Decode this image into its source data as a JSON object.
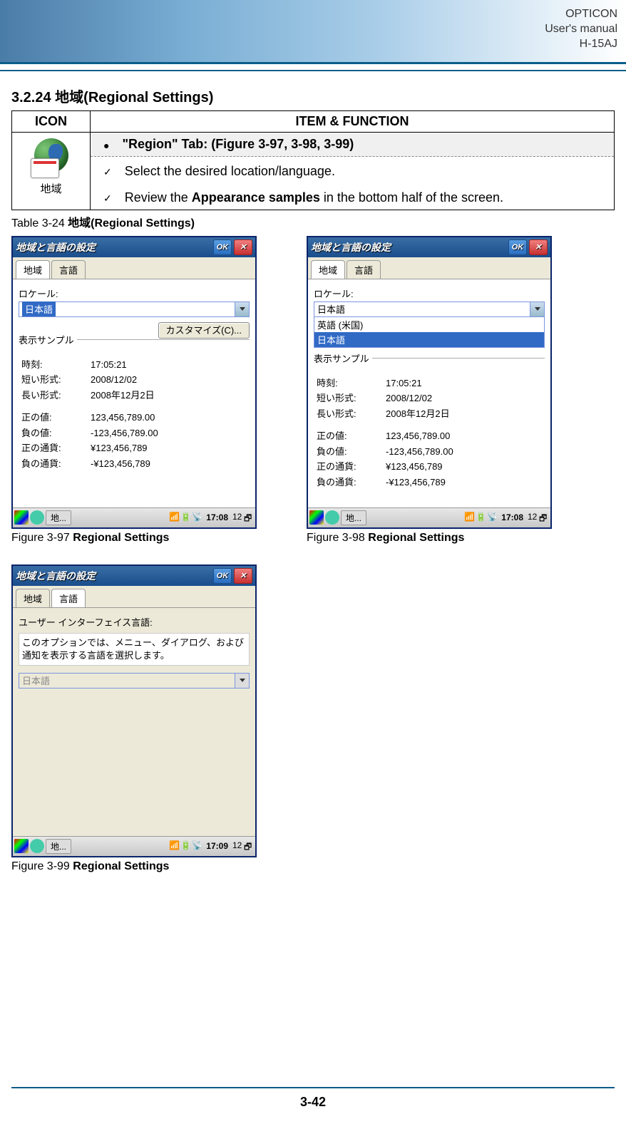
{
  "header": {
    "line1": "OPTICON",
    "line2": "User's manual",
    "line3": "H-15AJ"
  },
  "section_title": "3.2.24  地域(Regional Settings)",
  "main_table": {
    "header_icon": "ICON",
    "header_func": "ITEM & FUNCTION",
    "icon_label": "地域",
    "tab_heading": "\"Region\" Tab: (Figure 3-97, 3-98, 3-99)",
    "step1": "Select the desired location/language.",
    "step2_pre": "Review the ",
    "step2_bold": "Appearance samples",
    "step2_post": " in the bottom half of the screen."
  },
  "table_caption_pre": "Table 3-24 ",
  "table_caption_bold": "地域(Regional Settings)",
  "fig97_caption_pre": "Figure 3-97 ",
  "fig97_caption_bold": "Regional Settings",
  "fig98_caption_pre": "Figure 3-98 ",
  "fig98_caption_bold": "Regional Settings",
  "fig99_caption_pre": "Figure 3-99 ",
  "fig99_caption_bold": "Regional Settings",
  "dlg": {
    "title": "地域と言語の設定",
    "ok": "OK",
    "tab_region": "地域",
    "tab_lang": "言語",
    "locale_label": "ロケール:",
    "locale_value": "日本語",
    "option_en": "英語 (米国)",
    "option_jp": "日本語",
    "customize": "カスタマイズ(C)...",
    "sample_label": "表示サンプル",
    "row_time_l": "時刻:",
    "row_time_v": "17:05:21",
    "row_sd_l": "短い形式:",
    "row_sd_v": "2008/12/02",
    "row_ld_l": "長い形式:",
    "row_ld_v": "2008年12月2日",
    "row_pos_l": "正の値:",
    "row_pos_v": "123,456,789.00",
    "row_neg_l": "負の値:",
    "row_neg_v": "-123,456,789.00",
    "row_pc_l": "正の通貨:",
    "row_pc_v": "¥123,456,789",
    "row_nc_l": "負の通貨:",
    "row_nc_v": "-¥123,456,789",
    "ui_lang_label": "ユーザー インターフェイス言語:",
    "ui_lang_desc": "このオプションでは、メニュー、ダイアログ、および通知を表示する言語を選択します。",
    "ui_lang_value": "日本語"
  },
  "taskbar": {
    "task_label": "地...",
    "time1": "17:08",
    "time2": "17:09",
    "sip": "12"
  },
  "page_number": "3-42"
}
